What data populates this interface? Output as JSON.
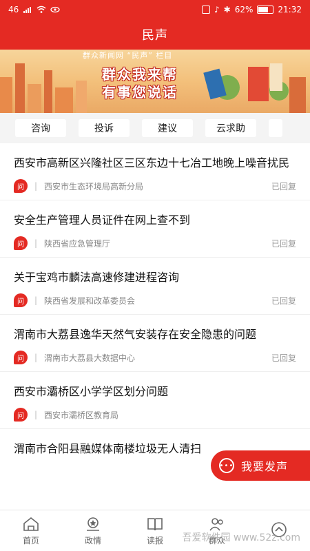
{
  "status_bar": {
    "signal": "46",
    "battery": "62%",
    "time": "21:32"
  },
  "header": {
    "title": "民声"
  },
  "banner": {
    "subtitle": "群众新闻网 “民声” 栏目",
    "line1": "群众我来帮",
    "line2": "有事您说话"
  },
  "tabs": [
    {
      "label": "咨询"
    },
    {
      "label": "投诉"
    },
    {
      "label": "建议"
    },
    {
      "label": "云求助"
    }
  ],
  "items": [
    {
      "title": "西安市高新区兴隆社区三区东边十七冶工地晚上噪音扰民",
      "badge": "问",
      "department": "西安市生态环境局高新分局",
      "status": "已回复"
    },
    {
      "title": "安全生产管理人员证件在网上查不到",
      "badge": "问",
      "department": "陕西省应急管理厅",
      "status": "已回复"
    },
    {
      "title": "关于宝鸡市麟法高速修建进程咨询",
      "badge": "问",
      "department": "陕西省发展和改革委员会",
      "status": "已回复"
    },
    {
      "title": "渭南市大荔县逸华天然气安装存在安全隐患的问题",
      "badge": "问",
      "department": "渭南市大荔县大数据中心",
      "status": "已回复"
    },
    {
      "title": "西安市灞桥区小学学区划分问题",
      "badge": "问",
      "department": "西安市灞桥区教育局",
      "status": ""
    },
    {
      "title": "渭南市合阳县融媒体南楼垃圾无人清扫",
      "badge": "",
      "department": "",
      "status": ""
    }
  ],
  "fab": {
    "label": "我要发声"
  },
  "bottom_nav": [
    {
      "label": "首页",
      "icon": "home-icon"
    },
    {
      "label": "政情",
      "icon": "government-icon"
    },
    {
      "label": "读报",
      "icon": "book-icon"
    },
    {
      "label": "群众",
      "icon": "people-icon"
    },
    {
      "label": "",
      "icon": "up-icon"
    }
  ],
  "watermark": "吾爱软件园 www.52z.com",
  "colors": {
    "accent": "#e42a23",
    "tab_bar_bg": "#f4f4f4"
  }
}
